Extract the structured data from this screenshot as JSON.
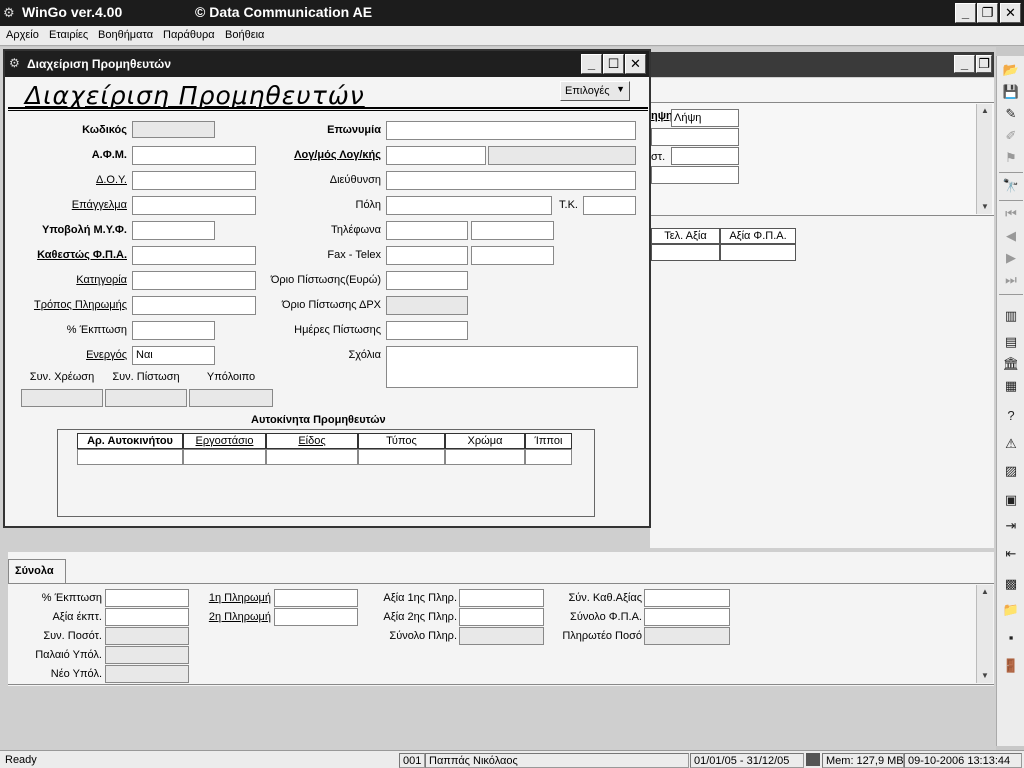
{
  "app": {
    "title": "WinGo ver.4.00",
    "copyright": "© Data Communication AE"
  },
  "window_buttons": {
    "minimize": "_",
    "restore": "❐",
    "close": "✕"
  },
  "menu": [
    "Αρχείο",
    "Εταιρίες",
    "Βοηθήματα",
    "Παράθυρα",
    "Βοήθεια"
  ],
  "background_window": {
    "label_fragment": "ηψη",
    "value": "Λήψη",
    "label_fragment2": "στ.",
    "grid_headers": [
      "Τελ. Αξία",
      "Αξία Φ.Π.Α."
    ]
  },
  "dialog": {
    "window_title": "Διαχείριση Προμηθευτών",
    "heading": "Διαχείριση Προμηθευτών",
    "options_label": "Επιλογές",
    "fields_left": {
      "code": "Κωδικός",
      "afm": "Α.Φ.Μ.",
      "doy": "Δ.Ο.Υ.",
      "profession": "Επάγγελμα",
      "myf": "Υποβολή Μ.Υ.Φ.",
      "vat_status": "Καθεστώς Φ.Π.Α.",
      "category": "Κατηγορία",
      "payment_method": "Τρόπος Πληρωμής",
      "discount": "% Έκπτωση",
      "active": "Ενεργός",
      "active_value": "Ναι"
    },
    "fields_right": {
      "name": "Επωνυμία",
      "account": "Λογ/μός Λογ/κής",
      "address": "Διεύθυνση",
      "city": "Πόλη",
      "zip": "Τ.Κ.",
      "phones": "Τηλέφωνα",
      "fax": "Fax - Telex",
      "credit_limit_eur": "Όριο Πίστωσης(Ευρώ)",
      "credit_limit_drx": "Όριο Πίστωσης ΔΡΧ",
      "credit_days": "Ημέρες Πίστωσης",
      "comments": "Σχόλια"
    },
    "summary": {
      "debit": "Συν. Χρέωση",
      "credit": "Συν. Πίστωση",
      "balance": "Υπόλοιπο"
    },
    "cars": {
      "title": "Αυτοκίνητα Προμηθευτών",
      "headers": [
        "Αρ. Αυτοκινήτου",
        "Εργοστάσιο",
        "Είδος",
        "Τύπος",
        "Χρώμα",
        "Ίπποι"
      ]
    }
  },
  "lower": {
    "tab": "Σύνολα",
    "col1": [
      "% Έκπτωση",
      "Αξία έκπτ.",
      "Συν. Ποσότ.",
      "Παλαιό Υπόλ.",
      "Νέο Υπόλ."
    ],
    "col2": [
      "1η Πληρωμή",
      "2η Πληρωμή"
    ],
    "col3": [
      "Αξία 1ης Πληρ.",
      "Αξία 2ης Πληρ.",
      "Σύνολο Πληρ."
    ],
    "col4": [
      "Σύν. Καθ.Αξίας",
      "Σύνολο Φ.Π.Α.",
      "Πληρωτέο  Ποσό"
    ]
  },
  "status": {
    "ready": "Ready",
    "company_code": "001",
    "user": "Παππάς Νικόλαος",
    "period": "01/01/05 - 31/12/05",
    "memory": "Mem: 127,9 MB",
    "datetime": "09-10-2006 13:13:44"
  }
}
